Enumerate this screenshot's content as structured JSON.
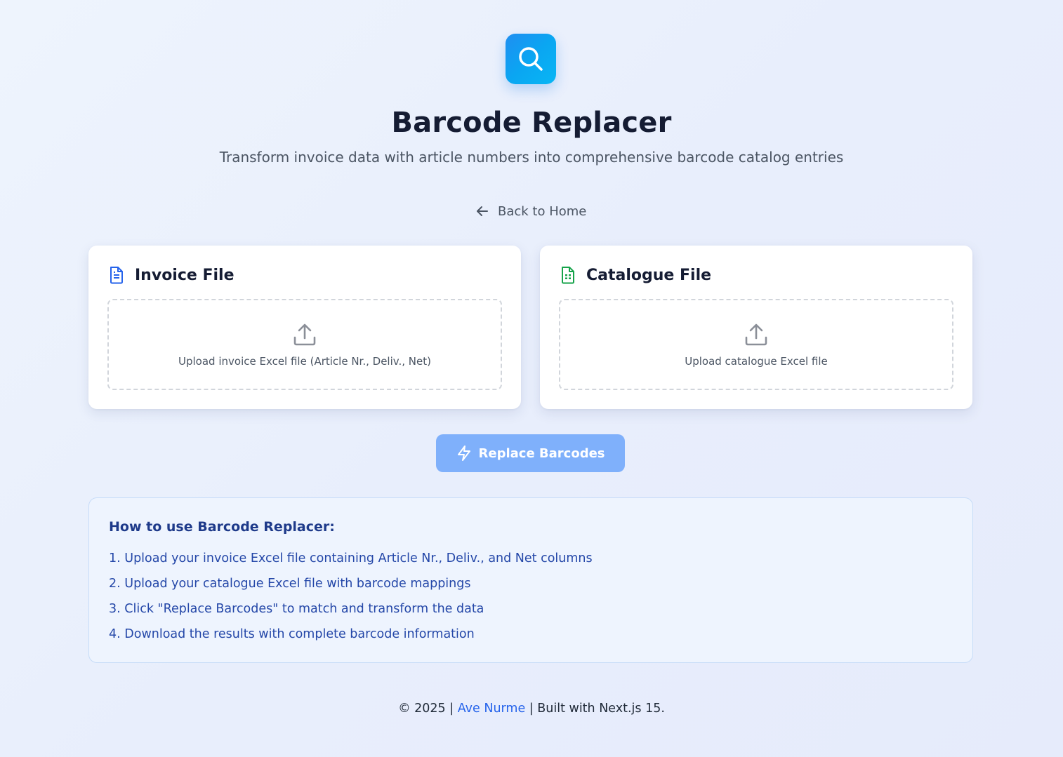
{
  "header": {
    "logo_icon": "search-icon",
    "title": "Barcode Replacer",
    "subtitle": "Transform invoice data with article numbers into comprehensive barcode catalog entries"
  },
  "nav": {
    "back_label": "Back to Home",
    "back_icon": "arrow-left-icon"
  },
  "cards": {
    "invoice": {
      "title": "Invoice File",
      "icon": "document-icon",
      "icon_color": "#2563eb",
      "upload_label": "Upload invoice Excel file (Article Nr., Deliv., Net)"
    },
    "catalogue": {
      "title": "Catalogue File",
      "icon": "spreadsheet-icon",
      "icon_color": "#16a34a",
      "upload_label": "Upload catalogue Excel file"
    }
  },
  "action": {
    "replace_label": "Replace Barcodes",
    "replace_icon": "lightning-icon",
    "button_color": "#7fb0fb"
  },
  "howto": {
    "title": "How to use Barcode Replacer:",
    "steps": [
      "1. Upload your invoice Excel file containing Article Nr., Deliv., and Net columns",
      "2. Upload your catalogue Excel file with barcode mappings",
      "3. Click \"Replace Barcodes\" to match and transform the data",
      "4. Download the results with complete barcode information"
    ]
  },
  "footer": {
    "prefix": "© 2025 | ",
    "author": "Ave Nurme",
    "suffix": " | Built with Next.js 15."
  },
  "colors": {
    "accent": "#2563eb",
    "title_text": "#151c33",
    "howto_text": "#2447a8"
  }
}
